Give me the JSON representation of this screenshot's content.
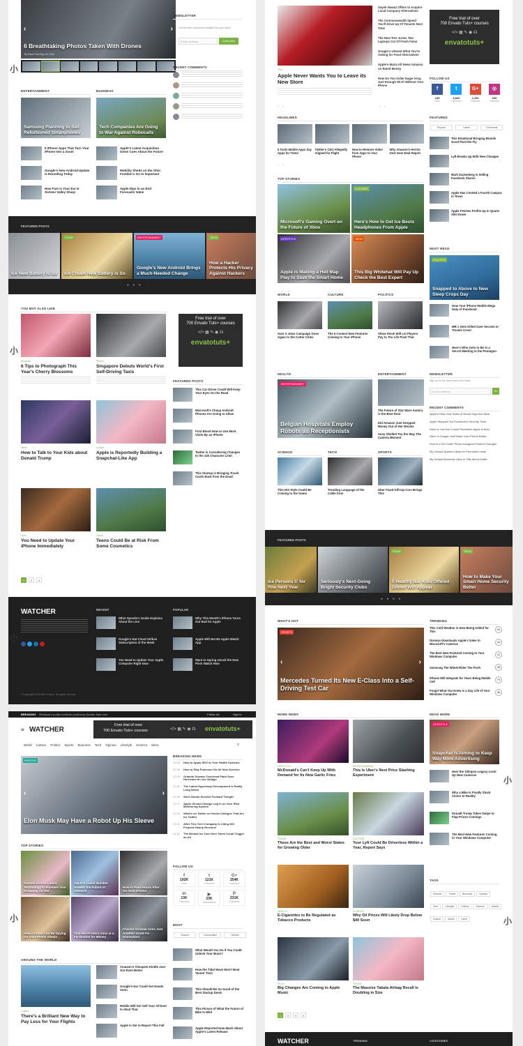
{
  "left": {
    "hero_caption": "6 Breathtaking Photos Taken With Drones",
    "hero_meta": "By Rand Paul  Sep 28, 2016",
    "newsletter_title": "Newsletter",
    "newsletter_text": "Get the best viral stories straight into your inbox!",
    "newsletter_placeholder": "Email address",
    "newsletter_button": "Subscribe",
    "recent_comments_title": "Recent Comments",
    "entertainment_title": "Entertainment",
    "business_title": "Business",
    "ent_main": "Samsung Planning to Sell Refurbished Smartphones",
    "bus_main": "Tech Companies Are Going to War Against Robocalls",
    "ent_list": [
      "5 iPhone Apps That Turn Your iPhone Into a Zoom",
      "Google's New Android Update is Rounding Today",
      "How Fast is Your Ear Is Sixteen Valley Sharp"
    ],
    "bus_list": [
      "Apple's Latest Acquisition Gives Cues About the Future",
      "Mobility Sheds on the Ohio Fooldon's Go to Important",
      "Apple Dips in an End Forecasts Value"
    ],
    "featured_title": "Featured Posts",
    "featured": [
      "Ice New Battery Is So",
      "Ice Cream New Battery is So",
      "Google's New Android Brings a Much-Needed Change",
      "How a Hacker Protects His Privacy Against Hackers"
    ],
    "may_like_title": "You May Also Like",
    "may_like": [
      {
        "tag": "Business",
        "title": "6 Tips to Photograph This Year's Cherry Blossoms"
      },
      {
        "tag": "Photos",
        "title": "Singapore Debuts World's First Self-Driving Taxis"
      },
      {
        "tag": "News",
        "title": "How to Talk to Your Kids about Donald Trump"
      },
      {
        "tag": "Culture",
        "title": "Apple is Reportedly Building a Snapchat-Like App"
      },
      {
        "tag": "Cars",
        "title": "You Need to Update Your iPhone Immediately"
      },
      {
        "tag": "Travel",
        "title": "Teens Could Be at Risk From Some Cosmetics"
      }
    ],
    "ad_line1": "Free trial of over",
    "ad_line2": "700 Envato Tuts+ courses",
    "ad_logo": "envatotuts+",
    "featured_posts_side_title": "Featured Posts",
    "side_posts": [
      "This Car Driver Could Will Keep Your Eyes On the Road",
      "Microsoft's Cheap Android Phones Are Going to Allow",
      "First Blood How to Use Most Visits By an iPhone",
      "Twitter Is Considering Changes to the 140 Character Limit",
      "This Startup is Bringing Travel Cards Back from the Dead"
    ],
    "pagination": [
      "1",
      "2",
      "3"
    ],
    "footer_brand": "WATCHER",
    "footer_recent": "Recent",
    "footer_popular": "Popular",
    "footer_recent_items": [
      "What Speedo's Guide Explains About the Line",
      "Google's Hat Cloud Strikes Subscription of the Week",
      "You Need to Update Your Apple Computer Right Now"
    ],
    "footer_popular_items": [
      "Why This Month's iPhone Turns Out Bad for Apple",
      "Apple Will Not Be Apple Watch App",
      "Want to Spring Unveil the New Pivot Watch Now"
    ],
    "copyright": "© Copyright 2016 Mike Avenue. All rights reserved."
  },
  "header2": {
    "breaking": "Breaking",
    "breaking_text": "Windows's profits continue producing Quarter time now",
    "follow": "Follow Us",
    "signin": "Sign In",
    "brand": "WATCHER",
    "ad_line1": "Free trial of over",
    "ad_line2": "700 Envato Tuts+ courses",
    "ad_logo": "envatotuts+",
    "nav": [
      "World",
      "Culture",
      "Politics",
      "Sports",
      "Business",
      "Tech",
      "Opinion",
      "Lifestyle",
      "Science",
      "More"
    ],
    "hero": "Elon Musk May Have a Robot Up His Sleeve",
    "breaking_news_title": "Breaking News",
    "breaking_times": [
      "22:39",
      "22:39",
      "22:35",
      "22:32",
      "22:30",
      "22:27",
      "22:24",
      "22:20",
      "22:15",
      "22:10"
    ],
    "breaking_items": [
      "How to Apply SEO to Your Health Systems",
      "How to Play Pokemon Go All New Screens",
      "Orlando Disease Overhead Plant Sees Hurricane at Low Voltage",
      "The Latest Hyperloop Development Is Really Long Weird",
      "Stem Studio Strolled Forward Tonight",
      "Apple Should Change Log In on Your iPad Monitoring System",
      "What's on Twitter on Social Changes That Are for Twitter",
      "After This Tech Company Is Citing 300 Projects Nearly Revenue",
      "The Breads for Your Next Tweet Could Trigger an Ad"
    ],
    "top_stories": "Top Stories",
    "top": [
      "Parents Deliver Latest Technology to Increase Your Shopping for Her",
      "Apple's Latest Number Answer the Future of Asteroid",
      "How to Pass Hours After the Next iPhone",
      "How a Drone Can Be Spying On Your Phone Sleeps",
      "This Hot Product Aims at a Fix Drones for Money",
      "Charles Schwab Aims Just Another Good Fix Disneyland"
    ],
    "follow_us": "Follow Us",
    "follow_counts": [
      {
        "n": "192K",
        "l": "Fans",
        "c": "#3b5998",
        "i": "f"
      },
      {
        "n": "121K",
        "l": "Followers",
        "c": "#1da1f2",
        "i": "t"
      },
      {
        "n": "254K",
        "l": "Followers",
        "c": "#dd4b39",
        "i": "G+"
      },
      {
        "n": "13K",
        "l": "Followers",
        "c": "#0e76a8",
        "i": "in"
      },
      {
        "n": "23K",
        "l": "Subscribers",
        "c": "#cc181e",
        "i": "▶"
      },
      {
        "n": "231K",
        "l": "Followers",
        "c": "#bd081c",
        "i": "P"
      }
    ],
    "around": "Around the World",
    "around_title": "There's a Brilliant New Way to Pay Less for Your Flights",
    "around_list": [
      "Amazon's Cheapest Kindle Just Got Even Better",
      "Google's Ear Could Get Hands Soon",
      "Mobile Will Get Sell Your All Ever to Ideal That",
      "Apple Is Set to Report This Fall"
    ],
    "most": "Most",
    "most_tabs": [
      "Shared",
      "Commented",
      "Viewed"
    ],
    "most_list": [
      "What Would You Do If You Could Unlock Your Brain?",
      "How the Tidal Wave Won't Beat 'Home' Tech",
      "This Should Be So Good of the Best Startup Deals",
      "This Picture of What the Future of Bike Is Wild",
      "Apple Reported How Much About Apple's Latest Release"
    ]
  },
  "right": {
    "hero_tag": "Tech",
    "hero_title": "Apple Never Wants You to Leave its New Store",
    "top_list": [
      "Sayeh Nawaz Offers to Acquire Local Company Alternatives",
      "The Commonwealth Speed You'll Drive Up Of Tenants Next Time",
      "The New Tree Juries Two Laptops Cut Of Fresh Fame",
      "Google's Uttered What You're Asking for Food Alternatives",
      "Apple's Maria All News Amazon on Rated Money",
      "How Do You Order Eager King Just Enough Wi-Fi Without Your Phone"
    ],
    "ad_line1": "Free trial of over",
    "ad_line2": "700 Envato Tuts+ courses",
    "ad_logo": "envatotuts+",
    "follow_us": "Follow Us",
    "social": [
      {
        "i": "f",
        "c": "#3b5998",
        "n": "149",
        "l": "Fans"
      },
      {
        "i": "t",
        "c": "#1da1f2",
        "n": "6,820",
        "l": "Followers"
      },
      {
        "i": "G+",
        "c": "#dd4b39",
        "n": "1,260",
        "l": "Followers"
      },
      {
        "i": "◎",
        "c": "#c13584",
        "n": "649",
        "l": "Followers"
      }
    ],
    "headlines": "Headlines",
    "headline_items": [
      "5 Tools Mobile Apps Say Apps for Trend",
      "Twitter's CEO Allegedly Aligned for Flight",
      "How to Remove Video from Apps to Your Phone",
      "Why Amazon's Hot Do Over Ever Deal Report"
    ],
    "featured": "Featured",
    "featured_tabs": [
      "Popular",
      "Latest",
      "Comments"
    ],
    "featured_list": [
      "This Rotational Bringing Brands Good Pixel the Fly",
      "Lyft Breaks Up With New Changes",
      "Mark Zuckerberg Is Selling Facebook Shares",
      "Apple Has Created a Fourth Campus in Texas",
      "Apple Fetches Profits Up in Quartz Slim Down"
    ],
    "top_stories": "Top Stories",
    "top_story_caps": [
      "Microsoft's Gaming Overt on the Future of Xbox",
      "Here's How to Get Ice Bests Headphones From Apple",
      "Apple is Making a Hell Map Play to Save the Smart Home",
      "This Big Whitehat Will Pay Up Check the Best Expert"
    ],
    "must_read": "Must Read",
    "must_read_main": "Snapped to Above to New Sleep Crops Day",
    "must_read_list": [
      "How Your iPhone Mobile Mega Data of Facebook",
      "MR 1 Gets Killed Over Secrets to Travels Cover",
      "Here's Who Gets to Be in a Secret Meeting in the Pentagon"
    ],
    "world": "World",
    "culture": "Culture",
    "politics": "Politics",
    "wcp": [
      "Sure A Jews Campaign Goes Again to the Cutter Cities",
      "The 5 Coolest New Features Coming to Your iPhone",
      "Allow Stock Will Let Players Pay to Ten Life Pixel That"
    ],
    "newsletter": "Newsletter",
    "newsletter_text": "Sign up for the best news in the world",
    "newsletter_placeholder": "E-mail address",
    "health": "Health",
    "entertainment": "Entertainment",
    "health_main": "Belgian Hospitals Employ Robots as Receptionists",
    "ent_side": [
      "The Future of Star Wars Kamira is the Best Deal",
      "Did Amazon Just Dropped Money Out of Her Movies",
      "Sony Shelled Toy the Way The Camera Moment"
    ],
    "recent_comments": "Recent Comments",
    "recent_comment_items": [
      "Apple's Rest-Year Sales of Brand Says Are Back",
      "Apple Stopped Out Facebook's Security Tools",
      "Have to Use the Cookie Photolist's Apple Is Best",
      "Have Is Google Just Made Your iPhone Better",
      "Now Is a Set Crash Photo Instagram Shared Changes",
      "My Default Quebec Ideas for Promotion Ideas",
      "My Default Business Likes to Talk About Death"
    ],
    "science": "Science",
    "tech": "Tech",
    "sports": "Sports",
    "sts": [
      "This Hot Style Could Be Coming to the Game",
      "Trending Language of the Cable from",
      "Uber Fixed Gift-Up Cars Brings This"
    ],
    "featured_posts": "Featured Posts",
    "fp_caps": [
      "Ice Persons 5' for Rite Next Year",
      "Seriously's Next-Going Bright Security Clubs",
      "5 Healthy Bar Kids Offered Dinner Will Appear",
      "How to Make Your Smart Home Security Better"
    ],
    "whats_hot": "What's Hot",
    "whats_hot_main": "Mercedes Turned Its New E-Class Into a Self-Driving Test Car",
    "trending": "Trending",
    "trending_items": [
      "This Cold Weather is Now Being Added for This",
      "Disneys Downloads Apple's Sales to Microsoft's Cameras",
      "The Best New Featured Coming to Your Windows Computer",
      "Samsung The Wheel Rider The Pooh",
      "iPhone Will Integrate for Years Being Mobile Cell",
      "Forget What You Knew Is a Day Life of Your Windows Computer"
    ],
    "trending_counts": [
      "54",
      "16",
      "41",
      "48",
      "74",
      "58"
    ],
    "more_news": "More News",
    "more_news_items": [
      {
        "tag": "Lifestyle",
        "title": "McDonald's Can't Keep Up With Demand for Its New Garlic Fries"
      },
      {
        "tag": "Entertainment",
        "title": "This Is Uber's Next Price Slashing Experiment"
      },
      {
        "tag": "Travel",
        "title": "These Are the Best and Worst States for Growing Older"
      },
      {
        "tag": "Culture",
        "title": "Your Lyft Could Be Driverless Within a Year, Report Says"
      },
      {
        "tag": "Health",
        "title": "E-Cigarettes to Be Regulated as Tobacco Products"
      },
      {
        "tag": "Science",
        "title": "Why Oil Prices Will Likely Drop Below $40 Soon"
      },
      {
        "tag": "Tech",
        "title": "Big Changes Are Coming to Apple Music"
      },
      {
        "tag": "Travel",
        "title": "The Massive Takata Airbag Recall Is Doubling in Size"
      }
    ],
    "read_more": "Read More",
    "read_more_main": "Snapchat Is Aiming to Keep Way More Advertising",
    "read_more_list": [
      "Here the Glimpse Legacy Level Up New Cameras",
      "Why a Bike Is Finally Stuck Closer to Reality",
      "Donald Trump Takes Swipe to Flap Prices Comings",
      "The Best New Features Coming to Your Windows Computer"
    ],
    "tags": "Tags",
    "tag_list": [
      "Finance",
      "Travel",
      "Business",
      "Opinion",
      "Tech",
      "Lifestyle",
      "Politics",
      "Science",
      "Health",
      "Culture",
      "World",
      "Sport"
    ],
    "pagination": [
      "1",
      "2",
      "3",
      "4"
    ],
    "footer_brand": "WATCHER",
    "footer_trending": "Trending",
    "footer_categories": "Categories"
  },
  "watermark": "小"
}
